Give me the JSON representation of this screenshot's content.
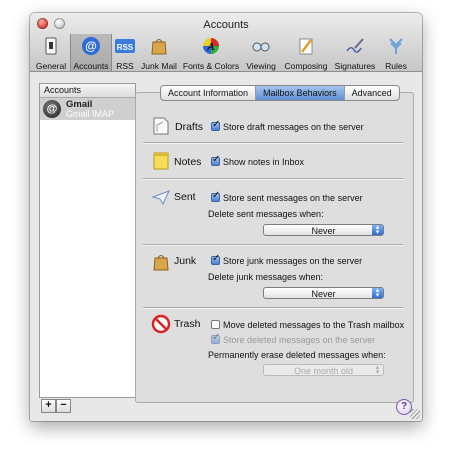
{
  "window": {
    "title": "Accounts"
  },
  "toolbar": {
    "items": [
      {
        "label": "General",
        "icon": "light-switch-icon"
      },
      {
        "label": "Accounts",
        "icon": "at-sign-icon",
        "selected": true
      },
      {
        "label": "RSS",
        "icon": "rss-icon"
      },
      {
        "label": "Junk Mail",
        "icon": "junk-bag-icon"
      },
      {
        "label": "Fonts & Colors",
        "icon": "fonts-colors-icon"
      },
      {
        "label": "Viewing",
        "icon": "glasses-icon"
      },
      {
        "label": "Composing",
        "icon": "pencil-icon"
      },
      {
        "label": "Signatures",
        "icon": "pen-signature-icon"
      },
      {
        "label": "Rules",
        "icon": "rules-icon"
      }
    ]
  },
  "sidebar": {
    "header": "Accounts",
    "accounts": [
      {
        "name": "Gmail",
        "type": "Gmail IMAP",
        "avatar": "@"
      }
    ],
    "add_label": "+",
    "remove_label": "−"
  },
  "tabs": [
    {
      "label": "Account Information"
    },
    {
      "label": "Mailbox Behaviors",
      "active": true
    },
    {
      "label": "Advanced"
    }
  ],
  "sections": {
    "drafts": {
      "title": "Drafts",
      "store_label": "Store draft messages on the server",
      "store_checked": true
    },
    "notes": {
      "title": "Notes",
      "show_label": "Show notes in Inbox",
      "show_checked": true
    },
    "sent": {
      "title": "Sent",
      "store_label": "Store sent messages on the server",
      "store_checked": true,
      "delete_label": "Delete sent messages when:",
      "delete_value": "Never"
    },
    "junk": {
      "title": "Junk",
      "store_label": "Store junk messages on the server",
      "store_checked": true,
      "delete_label": "Delete junk messages when:",
      "delete_value": "Never"
    },
    "trash": {
      "title": "Trash",
      "move_label": "Move deleted messages to the Trash mailbox",
      "move_checked": false,
      "store_label": "Store deleted messages on the server",
      "store_checked": true,
      "store_disabled": true,
      "erase_label": "Permanently erase deleted messages when:",
      "erase_value": "One month old",
      "erase_disabled": true
    }
  },
  "help_label": "?",
  "colors": {
    "accent": "#4c7fd0",
    "close": "#e0443a"
  }
}
